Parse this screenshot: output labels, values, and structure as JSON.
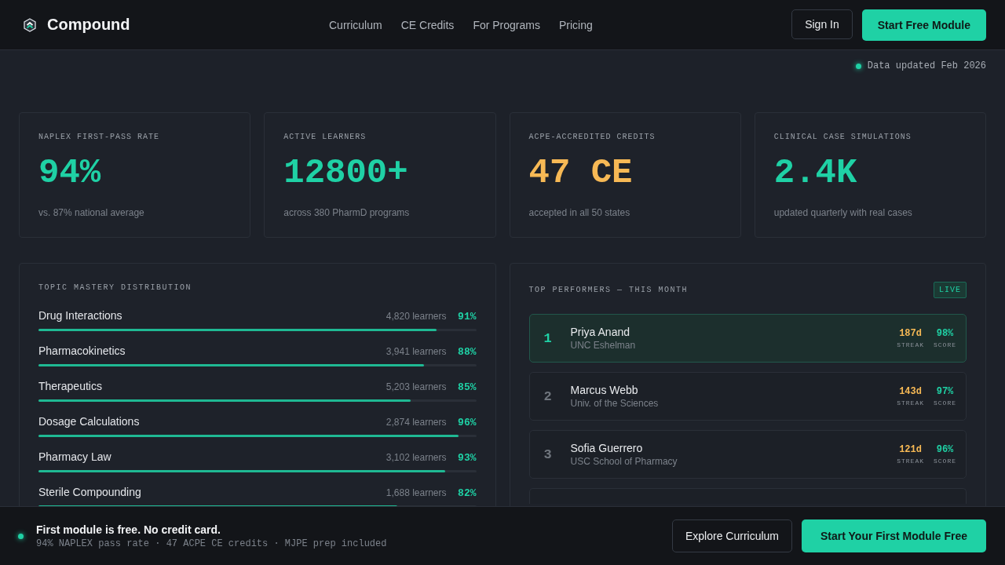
{
  "nav": {
    "brand": "Compound",
    "links": [
      "Curriculum",
      "CE Credits",
      "For Programs",
      "Pricing"
    ],
    "sign_in": "Sign In",
    "cta": "Start Free Module"
  },
  "hero": {
    "updated": "Data updated Feb 2026"
  },
  "stats": [
    {
      "label": "NAPLEX FIRST-PASS RATE",
      "value": "94%",
      "note": "vs. 87% national average",
      "color": "#1fd1a5"
    },
    {
      "label": "ACTIVE LEARNERS",
      "value": "12800+",
      "note": "across 380 PharmD programs",
      "color": "#1fd1a5"
    },
    {
      "label": "ACPE-ACCREDITED CREDITS",
      "value": "47 CE",
      "note": "accepted in all 50 states",
      "color": "#f7b955"
    },
    {
      "label": "CLINICAL CASE SIMULATIONS",
      "value": "2.4K",
      "note": "updated quarterly with real cases",
      "color": "#1fd1a5"
    }
  ],
  "mastery": {
    "title": "TOPIC MASTERY DISTRIBUTION",
    "topics": [
      {
        "name": "Drug Interactions",
        "learners": "4,820 learners",
        "percent": "91%",
        "level": 0.91
      },
      {
        "name": "Pharmacokinetics",
        "learners": "3,941 learners",
        "percent": "88%",
        "level": 0.88
      },
      {
        "name": "Therapeutics",
        "learners": "5,203 learners",
        "percent": "85%",
        "level": 0.85
      },
      {
        "name": "Dosage Calculations",
        "learners": "2,874 learners",
        "percent": "96%",
        "level": 0.96
      },
      {
        "name": "Pharmacy Law",
        "learners": "3,102 learners",
        "percent": "93%",
        "level": 0.93
      },
      {
        "name": "Sterile Compounding",
        "learners": "1,688 learners",
        "percent": "82%",
        "level": 0.82
      }
    ]
  },
  "performers": {
    "title": "TOP PERFORMERS — THIS MONTH",
    "badge": "LIVE",
    "rows": [
      {
        "rank": "1",
        "name": "Priya Anand",
        "school": "UNC Eshelman",
        "streak": "187d",
        "streak_label": "STREAK",
        "score": "98%",
        "score_label": "SCORE",
        "selected": true
      },
      {
        "rank": "2",
        "name": "Marcus Webb",
        "school": "Univ. of the Sciences",
        "streak": "143d",
        "streak_label": "STREAK",
        "score": "97%",
        "score_label": "SCORE",
        "selected": false
      },
      {
        "rank": "3",
        "name": "Sofia Guerrero",
        "school": "USC School of Pharmacy",
        "streak": "121d",
        "streak_label": "STREAK",
        "score": "96%",
        "score_label": "SCORE",
        "selected": false
      }
    ]
  },
  "footer": {
    "title": "First module is free. No credit card.",
    "subtitle": "94% NAPLEX pass rate · 47 ACPE CE credits · MJPE prep included",
    "secondary": "Explore Curriculum",
    "primary": "Start Your First Module Free"
  }
}
